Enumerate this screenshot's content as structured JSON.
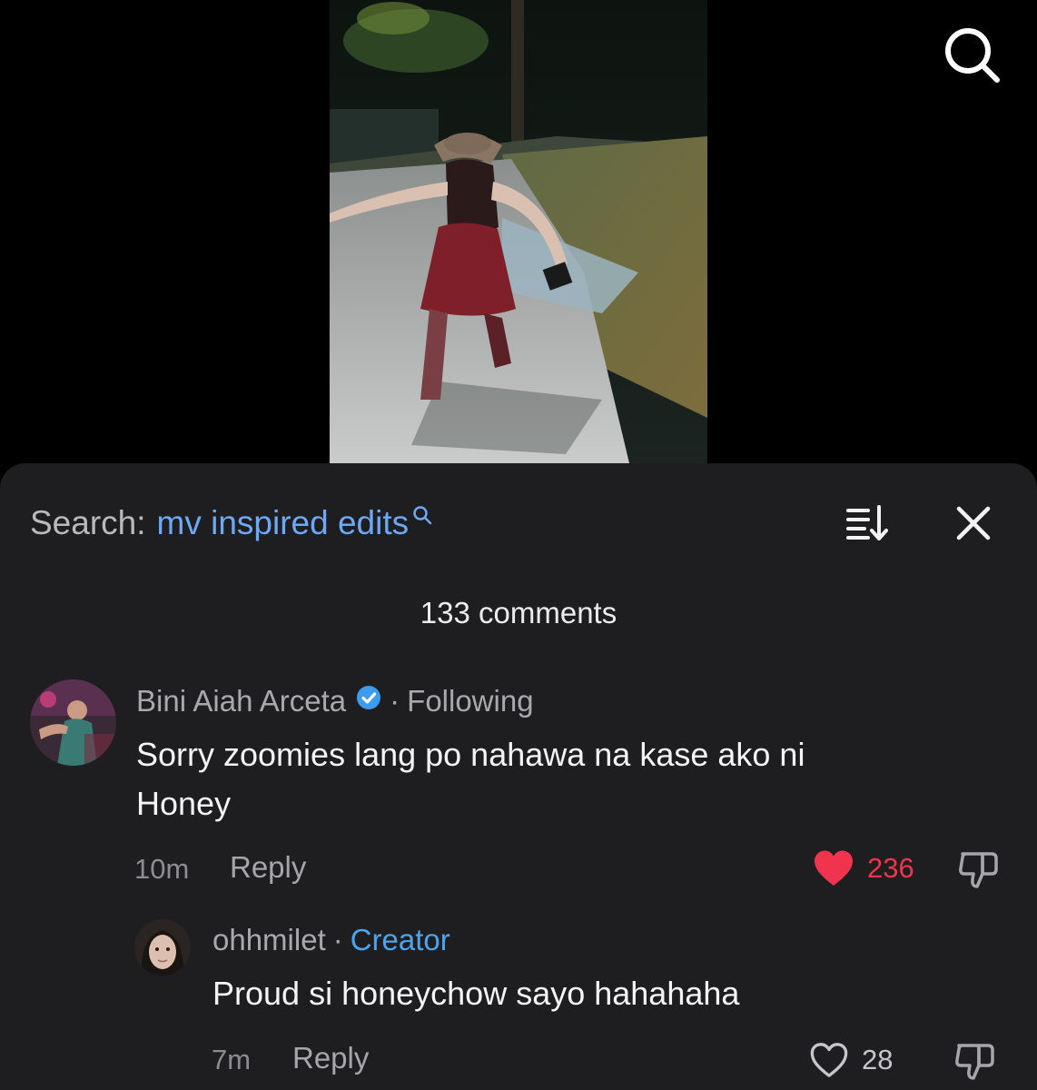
{
  "header": {
    "search_icon": "search-icon"
  },
  "search_bar": {
    "prefix": "Search:",
    "term": "mv inspired edits",
    "term_icon": "search-small-icon",
    "sort_icon": "sort-icon",
    "close_icon": "close-icon"
  },
  "comments_header": {
    "count_label": "133 comments"
  },
  "comments": [
    {
      "author": "Bini Aiah Arceta",
      "verified": true,
      "relationship": "Following",
      "text_lines": [
        "Sorry zoomies lang po nahawa na kase ako ni",
        "Honey"
      ],
      "time": "10m",
      "reply_label": "Reply",
      "likes": "236",
      "liked": true
    }
  ],
  "replies": [
    {
      "author": "ohhmilet",
      "badge": "Creator",
      "text": "Proud si honeychow sayo hahahaha",
      "time": "7m",
      "reply_label": "Reply",
      "likes": "28",
      "liked": false
    }
  ],
  "colors": {
    "sheet_bg": "#1e1e20",
    "link_blue": "#6ea8f4",
    "creator_blue": "#4ea4ea",
    "verified_blue": "#3c9cf0",
    "like_red": "#f0344f"
  }
}
